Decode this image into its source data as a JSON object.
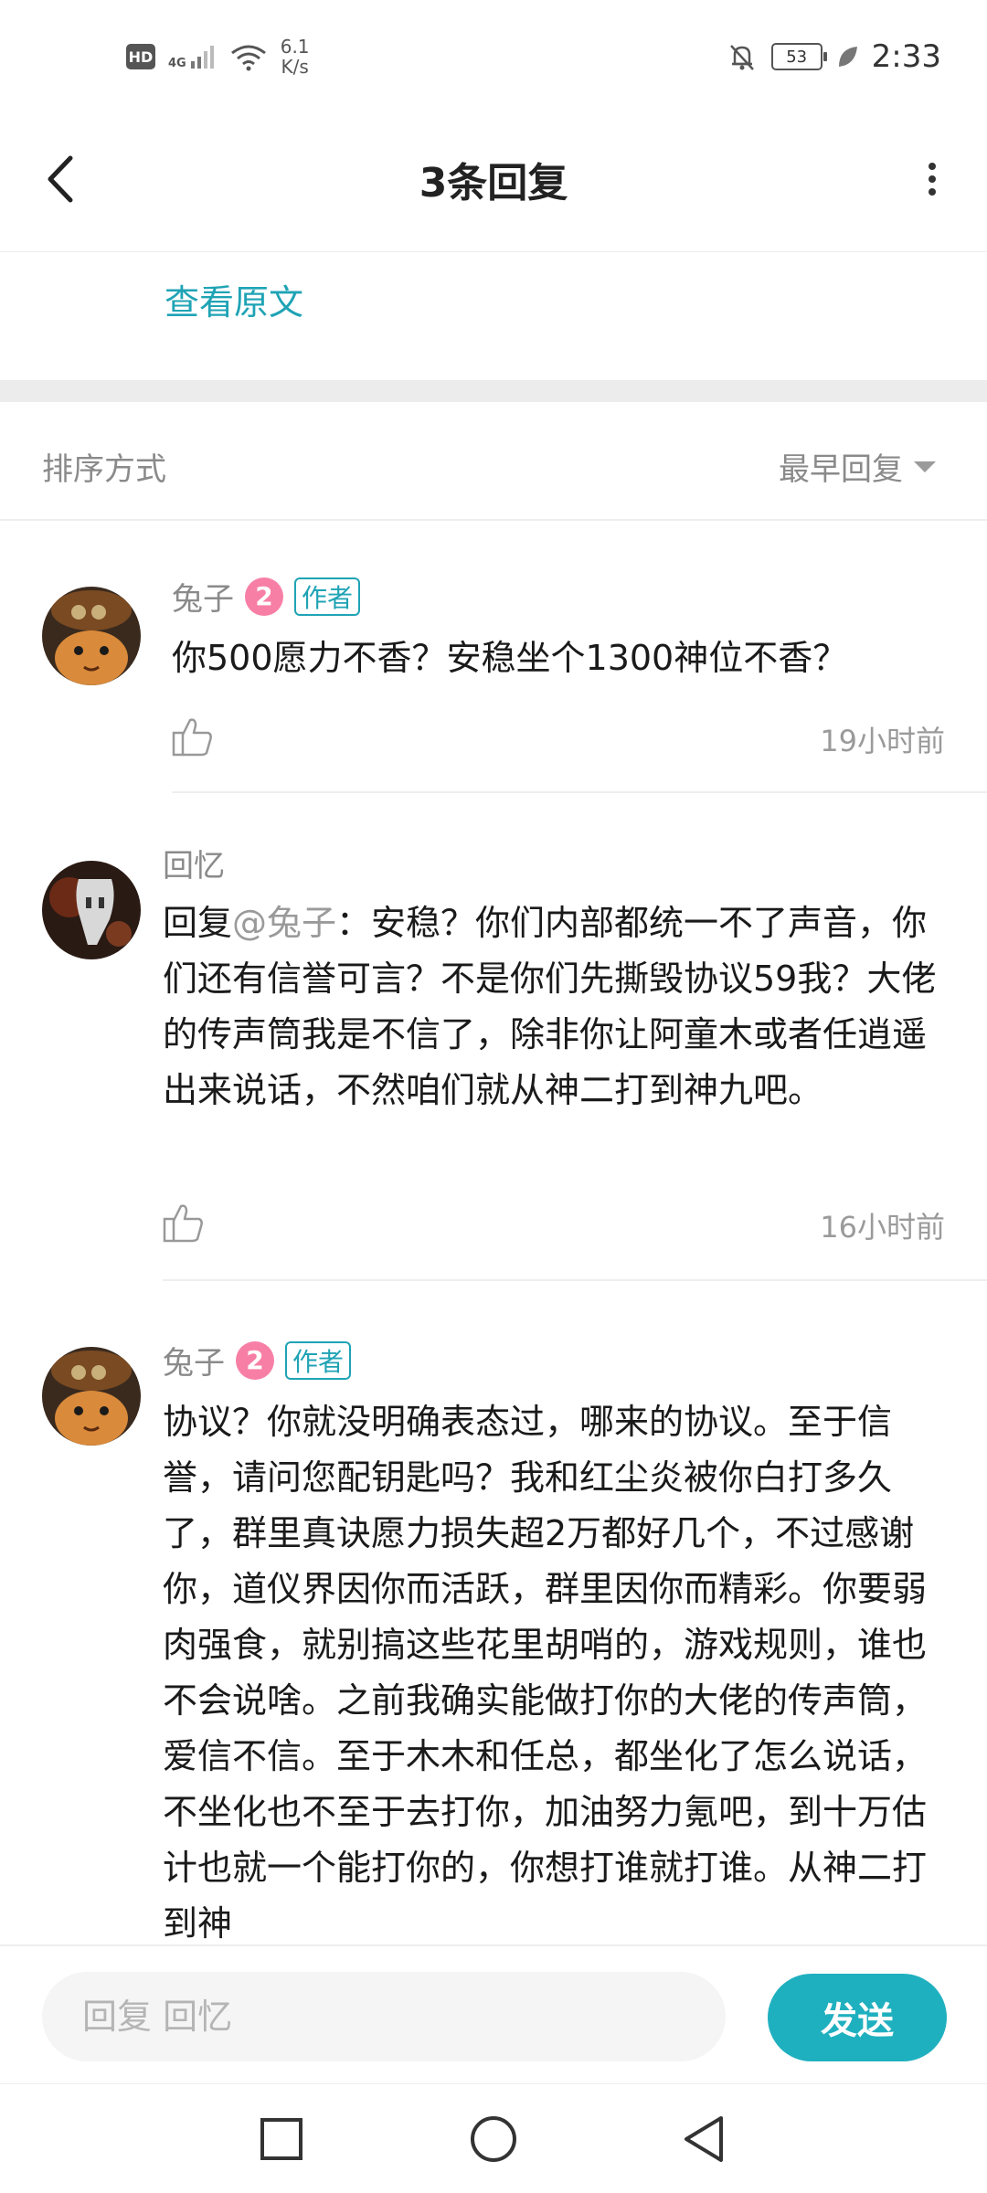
{
  "status_bar": {
    "hd": "HD",
    "network": "4G",
    "speed_value": "6.1",
    "speed_unit": "K/s",
    "battery": "53",
    "time": "2:33"
  },
  "header": {
    "title": "3条回复"
  },
  "view_original": "查看原文",
  "sort": {
    "label": "排序方式",
    "value": "最早回复"
  },
  "comments": [
    {
      "author": "兔子",
      "level": "2",
      "badge": "作者",
      "text": "你500愿力不香？安稳坐个1300神位不香？",
      "time": "19小时前"
    },
    {
      "author": "回忆",
      "reply_prefix": "回复",
      "mention": "@兔子",
      "text": "：安稳？你们内部都统一不了声音，你们还有信誉可言？不是你们先撕毁协议59我？大佬的传声筒我是不信了，除非你让阿童木或者任逍遥出来说话，不然咱们就从神二打到神九吧。",
      "time": "16小时前"
    },
    {
      "author": "兔子",
      "level": "2",
      "badge": "作者",
      "text": "协议？你就没明确表态过，哪来的协议。至于信誉，请问您配钥匙吗？我和红尘炎被你白打多久了，群里真诀愿力损失超2万都好几个，不过感谢你，道仪界因你而活跃，群里因你而精彩。你要弱肉强食，就别搞这些花里胡哨的，游戏规则，谁也不会说啥。之前我确实能做打你的大佬的传声筒，爱信不信。至于木木和任总，都坐化了怎么说话，不坐化也不至于去打你，加油努力氪吧，到十万估计也就一个能打你的，你想打谁就打谁。从神二打到神"
    }
  ],
  "reply_bar": {
    "placeholder": "回复 回忆",
    "send_label": "发送"
  },
  "colors": {
    "accent": "#1fa3b5",
    "send_button": "#1fb0bf",
    "level_badge": "#f77fa6"
  },
  "icons": [
    "back-arrow-icon",
    "more-vertical-icon",
    "thumbs-up-icon",
    "caret-down-icon",
    "square-nav-icon",
    "circle-nav-icon",
    "triangle-back-nav-icon"
  ]
}
